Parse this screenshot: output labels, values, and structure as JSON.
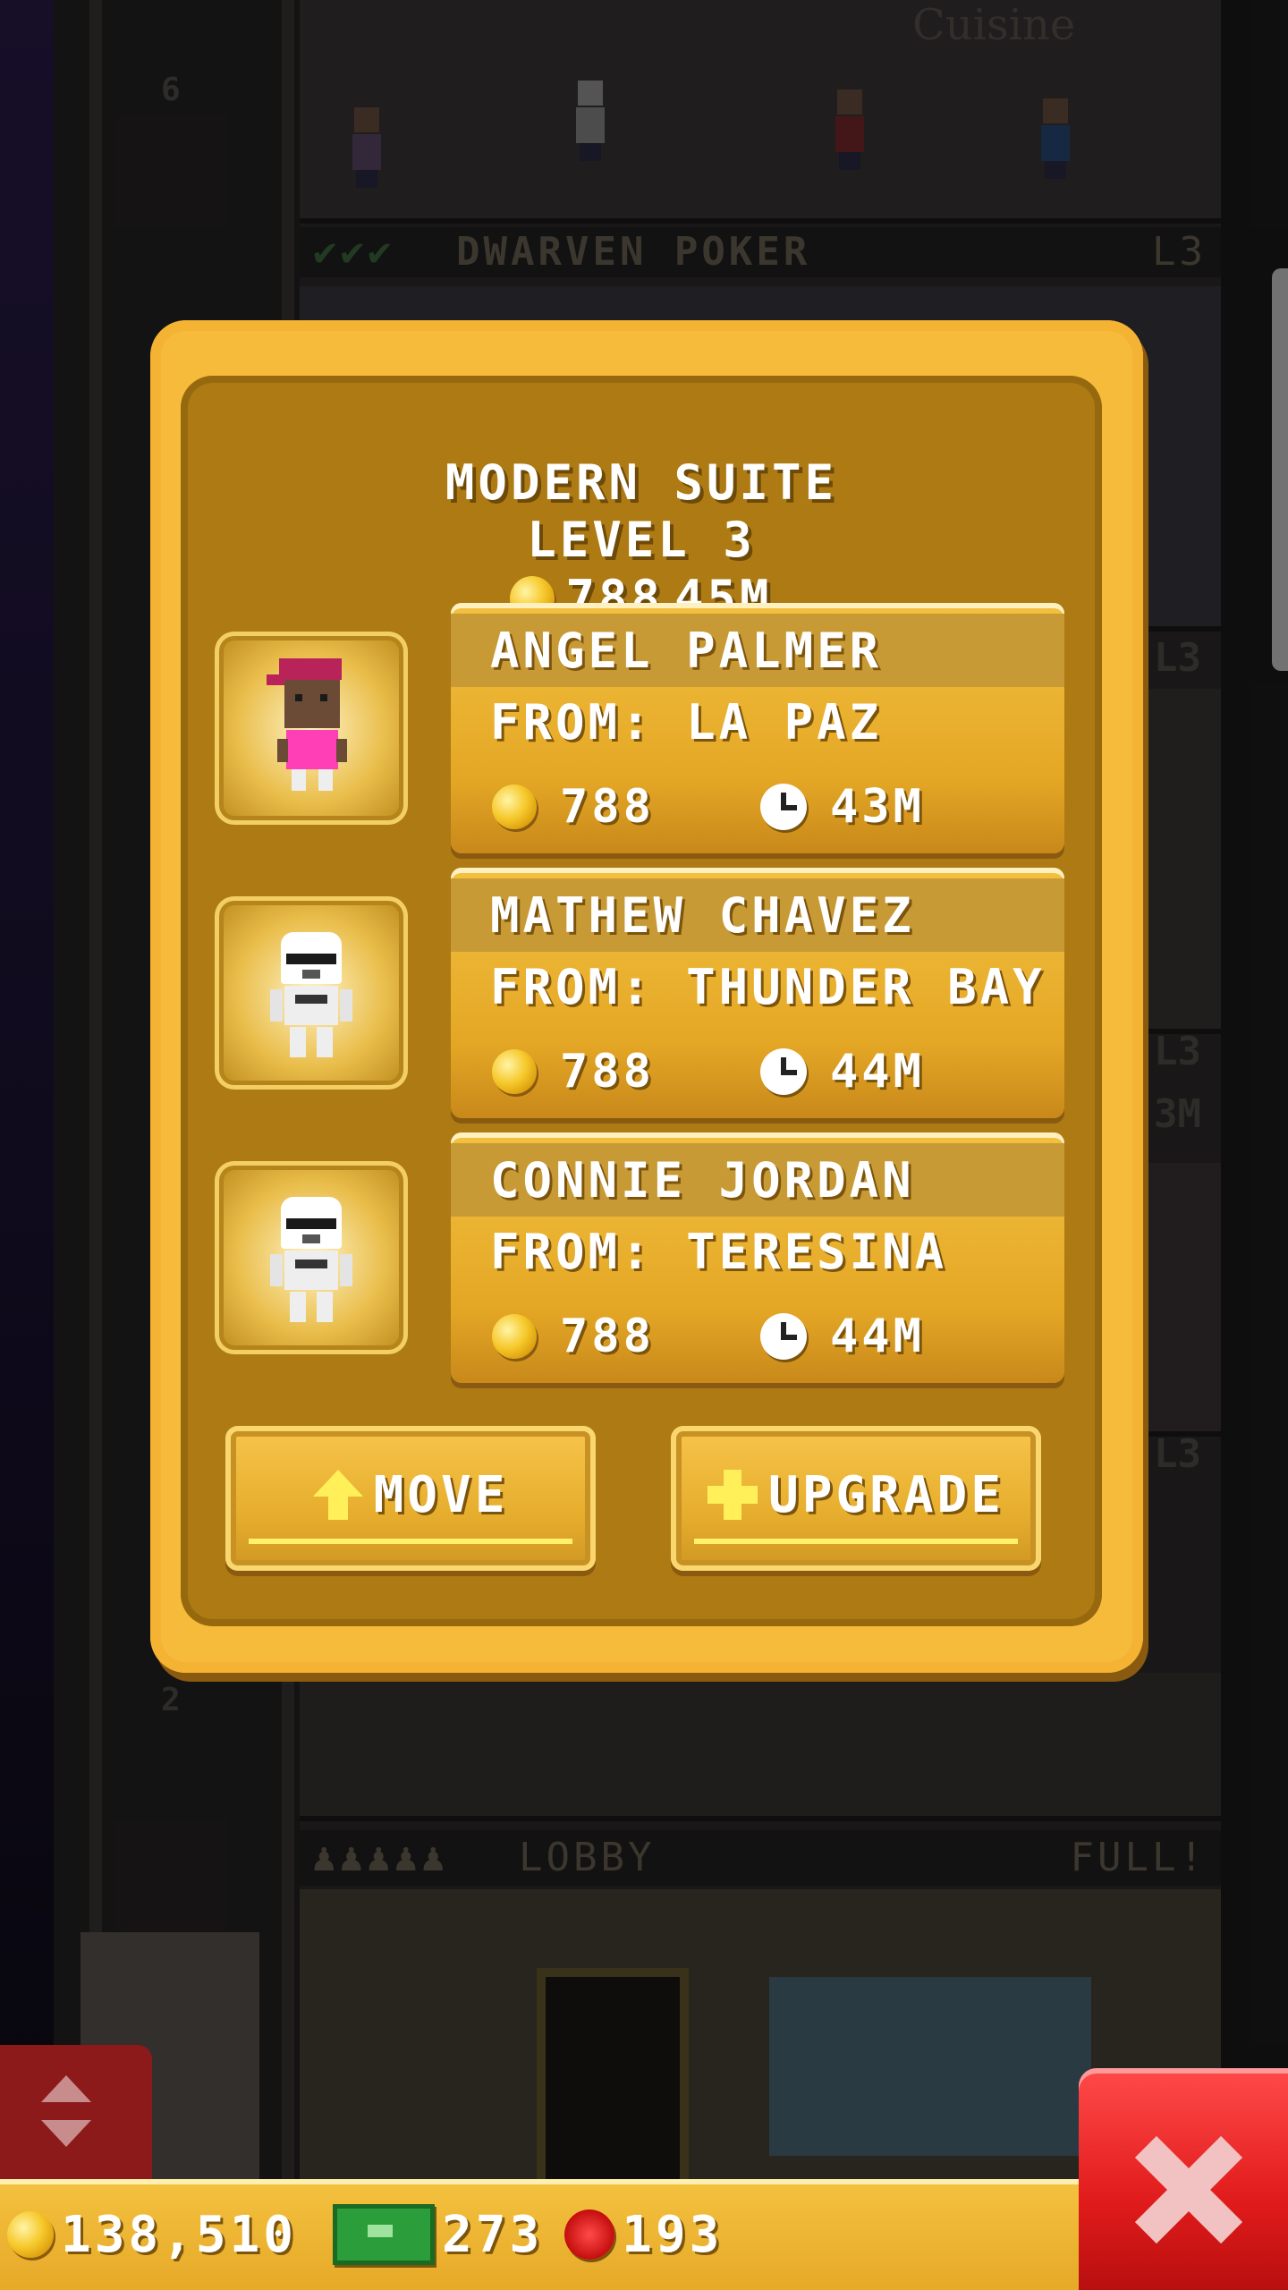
{
  "dialog": {
    "title": "MODERN SUITE",
    "level": "LEVEL 3",
    "coins": "788",
    "time": "45M"
  },
  "guests": [
    {
      "name": "ANGEL PALMER",
      "from": "FROM: LA PAZ",
      "coins": "788",
      "time": "43M",
      "avatar": "pink-cap-girl"
    },
    {
      "name": "MATHEW CHAVEZ",
      "from": "FROM: THUNDER BAY",
      "coins": "788",
      "time": "44M",
      "avatar": "stormtrooper"
    },
    {
      "name": "CONNIE JORDAN",
      "from": "FROM: TERESINA",
      "coins": "788",
      "time": "44M",
      "avatar": "stormtrooper"
    }
  ],
  "buttons": {
    "move": "MOVE",
    "upgrade": "UPGRADE"
  },
  "background": {
    "floor_top_name": "DWARVEN POKER",
    "floor_top_tag": "L3",
    "floor_top_checks": "✔✔✔",
    "floor_top_num": "6",
    "sign_partial": "Cuisine",
    "floor_lower_num": "2",
    "lobby_name": "LOBBY",
    "lobby_status": "FULL!",
    "side_tags": [
      "L3",
      "L3",
      "3M",
      "L3"
    ]
  },
  "hud": {
    "coins": "138,510",
    "cash": "273",
    "bux": "193"
  },
  "colors": {
    "dialog_outer": "#f7bb3c",
    "dialog_inner": "#ad7a14",
    "card_gold": "#e4a725",
    "close_red": "#e11b1b",
    "cash_green": "#2b9d3a"
  }
}
